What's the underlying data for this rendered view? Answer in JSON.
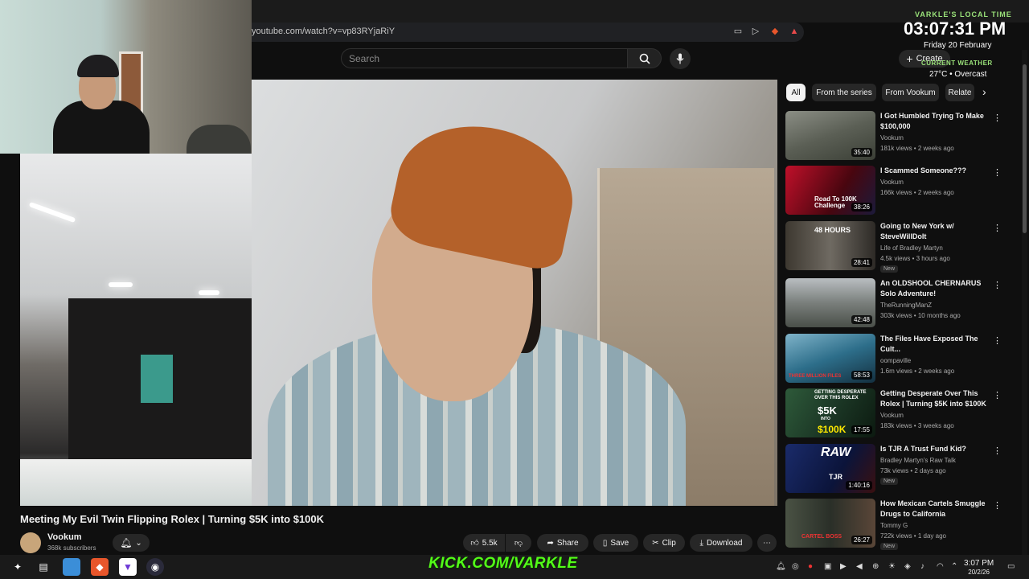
{
  "browser": {
    "url": "youtube.com/watch?v=vp83RYjaRiY"
  },
  "header": {
    "search_placeholder": "Search",
    "create_label": "Create"
  },
  "overlay": {
    "label": "VARKLE'S LOCAL TIME",
    "time": "03:07:31 PM",
    "date": "Friday 20 February",
    "weather_label": "CURRENT WEATHER",
    "weather": "27°C • Overcast"
  },
  "video": {
    "title": "Meeting My Evil Twin Flipping Rolex | Turning $5K into $100K",
    "channel": "Vookum",
    "subscribers": "368k subscribers",
    "likes": "5.5k",
    "share": "Share",
    "save": "Save",
    "clip": "Clip",
    "download": "Download"
  },
  "chips": [
    {
      "label": "All"
    },
    {
      "label": "From the series"
    },
    {
      "label": "From Vookum"
    },
    {
      "label": "Relate"
    }
  ],
  "related": [
    {
      "title": "I Got Humbled Trying To Make $100,000",
      "channel": "Vookum",
      "meta": "181k views • 2 weeks ago",
      "duration": "35:40",
      "new": ""
    },
    {
      "title": "I Scammed Someone???",
      "channel": "Vookum",
      "meta": "166k views • 2 weeks ago",
      "duration": "38:26",
      "new": ""
    },
    {
      "title": "Going to New York w/ SteveWillDoIt",
      "channel": "Life of Bradley Martyn",
      "meta": "4.5k views • 3 hours ago",
      "duration": "28:41",
      "new": "New"
    },
    {
      "title": "An OLDSHOOL CHERNARUS Solo Adventure!",
      "channel": "TheRunningManZ",
      "meta": "303k views • 10 months ago",
      "duration": "42:48",
      "new": ""
    },
    {
      "title": "The Files Have Exposed The Cult...",
      "channel": "oompaville",
      "meta": "1.6m views • 2 weeks ago",
      "duration": "58:53",
      "new": ""
    },
    {
      "title": "Getting Desperate Over This Rolex | Turning $5K into $100K",
      "channel": "Vookum",
      "meta": "183k views • 3 weeks ago",
      "duration": "17:55",
      "new": ""
    },
    {
      "title": "Is TJR A Trust Fund Kid?",
      "channel": "Bradley Martyn's Raw Talk",
      "meta": "73k views • 2 days ago",
      "duration": "1:40:16",
      "new": "New"
    },
    {
      "title": "How Mexican Cartels Smuggle Drugs to California",
      "channel": "Tommy G",
      "meta": "722k views • 1 day ago",
      "duration": "26:27",
      "new": "New"
    }
  ],
  "thumb_text": {
    "t2": "Road To 100K Challenge",
    "t3": "48 HOURS",
    "t5": "THREE MILLION FILES",
    "t6a": "GETTING DESPERATE OVER THIS ROLEX",
    "t6b": "$5K",
    "t6c": "INTO",
    "t6d": "$100K",
    "t7a": "RAW",
    "t7b": "TJR",
    "t8": "CARTEL BOSS"
  },
  "taskbar": {
    "kick": "KICK.COM/VARKLE",
    "time": "3:07 PM",
    "date": "20/2/26"
  },
  "colors": {
    "accent_green": "#53fc18",
    "overlay_green": "#9be37a",
    "bg": "#0f0f0f"
  }
}
